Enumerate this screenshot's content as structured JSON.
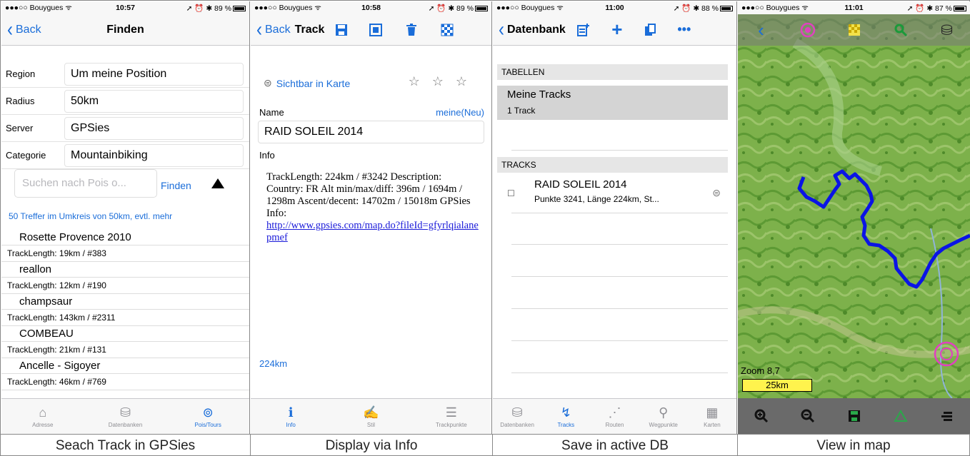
{
  "status_bars": [
    {
      "carrier": "●●●○○ Bouygues ᯤ",
      "time": "10:57",
      "right": "➚ ⏰ ✱ 89 %"
    },
    {
      "carrier": "●●●○○ Bouygues ᯤ",
      "time": "10:58",
      "right": "➚ ⏰ ✱ 89 %"
    },
    {
      "carrier": "●●●○○ Bouygues ᯤ",
      "time": "11:00",
      "right": "➚ ⏰ ✱ 88 %"
    },
    {
      "carrier": "●●●○○ Bouygues ᯤ",
      "time": "11:01",
      "right": "➚ ⏰ ✱ 87 %"
    }
  ],
  "search_screen": {
    "back": "Back",
    "title": "Finden",
    "fields": [
      {
        "label": "Region",
        "value": "Um meine Position"
      },
      {
        "label": "Radius",
        "value": "50km"
      },
      {
        "label": "Server",
        "value": "GPSies"
      },
      {
        "label": "Categorie",
        "value": "Mountainbiking"
      }
    ],
    "search_placeholder": "Suchen nach Pois o...",
    "find_button": "Finden",
    "hits": "50 Treffer im Umkreis von 50km, evtl. mehr",
    "results": [
      {
        "name": "Rosette Provence 2010",
        "info": "TrackLength: 19km / #383"
      },
      {
        "name": "reallon",
        "info": "TrackLength: 12km / #190"
      },
      {
        "name": "champsaur",
        "info": "TrackLength: 143km / #2311"
      },
      {
        "name": "COMBEAU",
        "info": "TrackLength: 21km / #131"
      },
      {
        "name": "Ancelle - Sigoyer",
        "info": "TrackLength: 46km / #769"
      }
    ],
    "tabs": [
      {
        "icon": "⌂",
        "label": "Adresse"
      },
      {
        "icon": "⛁",
        "label": "Datenbanken"
      },
      {
        "icon": "⊚",
        "label": "Pois/Tours"
      }
    ]
  },
  "info_screen": {
    "back": "Back",
    "title": "Track",
    "visible_label": "Sichtbar in Karte",
    "stars": "☆ ☆ ☆",
    "name_label": "Name",
    "name_link": "meine(Neu)",
    "name_value": "RAID SOLEIL 2014",
    "info_label": "Info",
    "info_text": "TrackLength: 224km / #3242 Description: Country: FR Alt min/max/diff: 396m / 1694m / 1298m Ascent/decent: 14702m / 15018m GPSies Info:",
    "info_link": "http://www.gpsies.com/map.do?fileId=gfyrlqialanepmef",
    "length": "224km",
    "tabs": [
      {
        "icon": "ℹ",
        "label": "Info"
      },
      {
        "icon": "✍",
        "label": "Stil"
      },
      {
        "icon": "☰",
        "label": "Trackpunkte"
      }
    ]
  },
  "db_screen": {
    "title": "Datenbank",
    "section_tables": "TABELLEN",
    "table_name": "Meine Tracks",
    "table_count": "1 Track",
    "section_tracks": "TRACKS",
    "track_name": "RAID SOLEIL 2014",
    "track_detail": "Punkte 3241, Länge 224km, St...",
    "tabs": [
      {
        "icon": "⛁",
        "label": "Datenbanken"
      },
      {
        "icon": "↯",
        "label": "Tracks"
      },
      {
        "icon": "⋰",
        "label": "Routen"
      },
      {
        "icon": "⚲",
        "label": "Wegpunkte"
      },
      {
        "icon": "▦",
        "label": "Karten"
      }
    ]
  },
  "map_screen": {
    "zoom": "Zoom 8,7",
    "scale": "25km",
    "track_color": "#0a14e6",
    "target_color": "#e040c0"
  },
  "captions": [
    "Seach Track in GPSies",
    "Display via Info",
    "Save in active DB",
    "View in map"
  ],
  "colors": {
    "accent": "#1a6dd9",
    "map_green": "#7bb04a"
  }
}
